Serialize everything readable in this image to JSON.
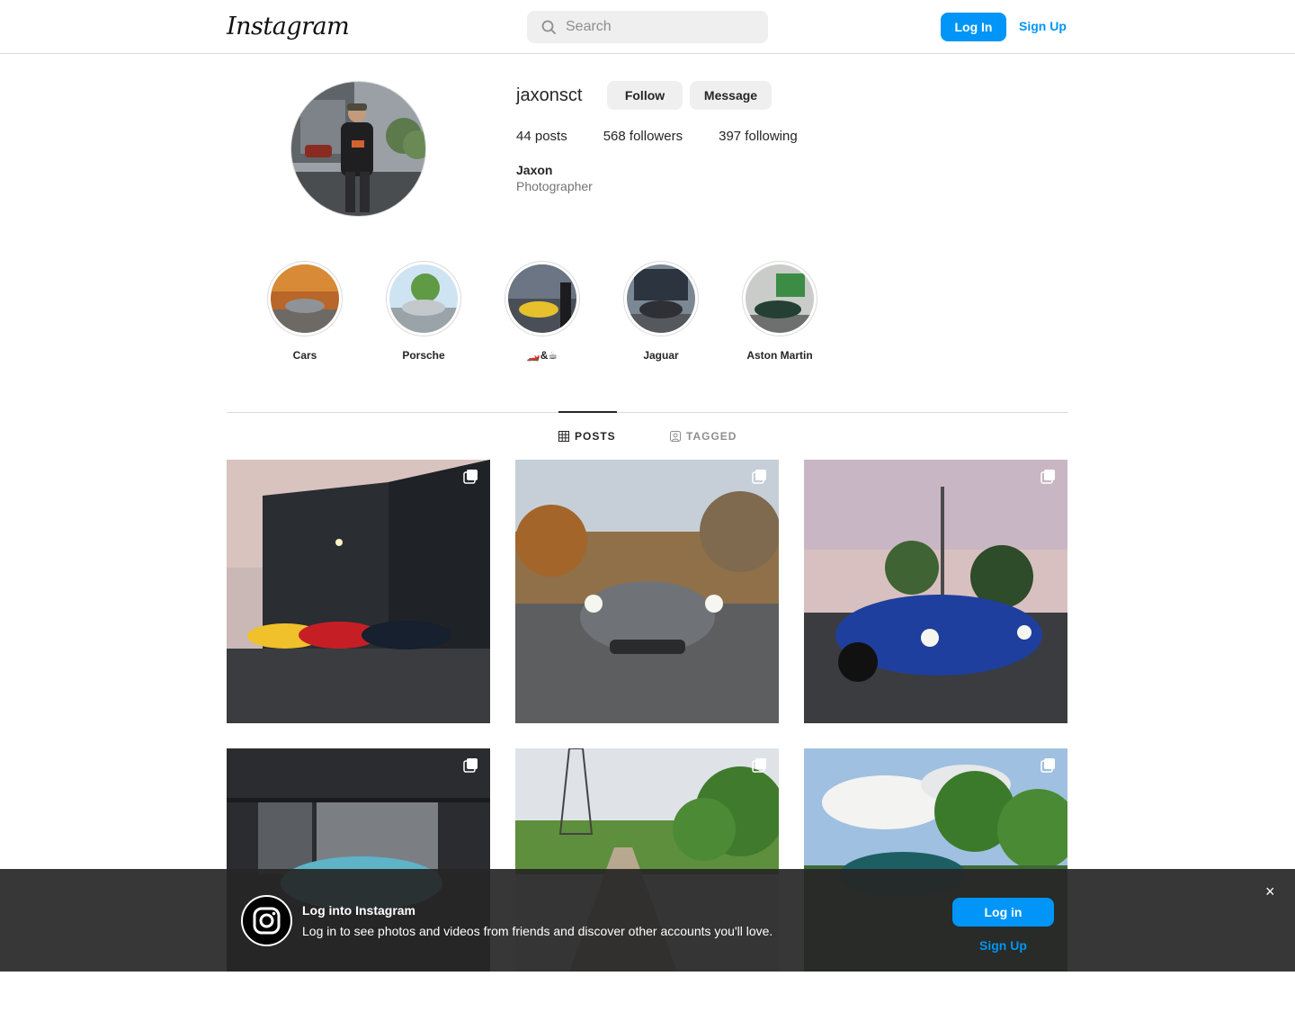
{
  "topnav": {
    "logo_text": "Instagram",
    "search_placeholder": "Search",
    "login_label": "Log In",
    "signup_label": "Sign Up"
  },
  "profile": {
    "username": "jaxonsct",
    "follow_label": "Follow",
    "message_label": "Message",
    "posts": "44 posts",
    "followers": "568 followers",
    "following": "397 following",
    "full_name": "Jaxon",
    "bio": "Photographer"
  },
  "highlights": [
    {
      "label": "Cars"
    },
    {
      "label": "Porsche"
    },
    {
      "label": "🏎️&☕"
    },
    {
      "label": "Jaguar"
    },
    {
      "label": "Aston Martin"
    }
  ],
  "tabs": {
    "posts_label": "POSTS",
    "tagged_label": "TAGGED"
  },
  "banner": {
    "title": "Log into Instagram",
    "subtitle": "Log in to see photos and videos from friends and discover other accounts you'll love.",
    "login_label": "Log in",
    "signup_label": "Sign Up",
    "close_glyph": "×"
  },
  "colors": {
    "accent": "#0095f6",
    "border": "#dbdbdb",
    "button_bg": "#efefef"
  }
}
